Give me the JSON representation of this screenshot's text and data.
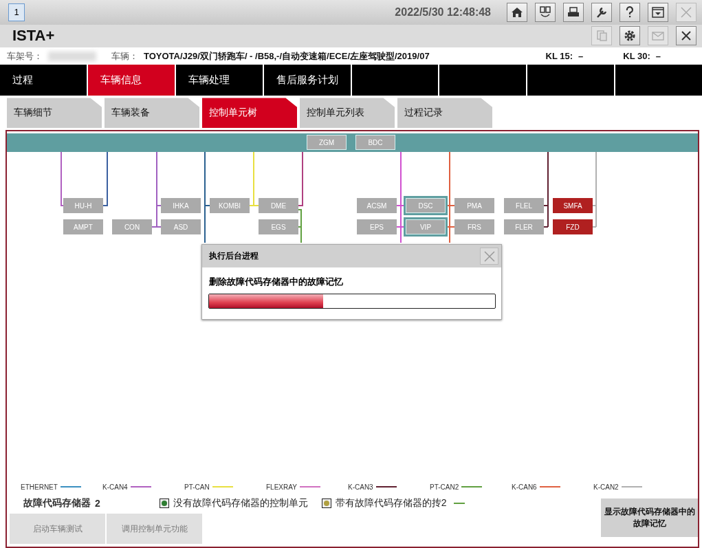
{
  "top_bar": {
    "window_number": "1",
    "datetime": "2022/5/30 12:48:48"
  },
  "app": {
    "title": "ISTA+"
  },
  "vehicle_info": {
    "vin_label": "车架号：",
    "vehicle_label": "车辆：",
    "vehicle": "TOYOTA/J29/双门轿跑车/ - /B58,-/自动变速箱/ECE/左座驾驶型/2019/07",
    "kl15_label": "KL 15:",
    "kl15_value": "–",
    "kl30_label": "KL 30:",
    "kl30_value": "–"
  },
  "main_tabs": [
    {
      "label": "过程",
      "selected": false
    },
    {
      "label": "车辆信息",
      "selected": true
    },
    {
      "label": "车辆处理",
      "selected": false
    },
    {
      "label": "售后服务计划",
      "selected": false
    }
  ],
  "sub_tabs": [
    {
      "label": "车辆细节",
      "selected": false
    },
    {
      "label": "车辆装备",
      "selected": false
    },
    {
      "label": "控制单元树",
      "selected": true
    },
    {
      "label": "控制单元列表",
      "selected": false
    },
    {
      "label": "过程记录",
      "selected": false
    }
  ],
  "bus_nodes": [
    {
      "label": "ZGM"
    },
    {
      "label": "BDC"
    }
  ],
  "ecu_nodes": [
    {
      "label": "HU-H",
      "fault": false,
      "selected": false
    },
    {
      "label": "IHKA",
      "fault": false,
      "selected": false
    },
    {
      "label": "KOMBI",
      "fault": false,
      "selected": false
    },
    {
      "label": "DME",
      "fault": false,
      "selected": false
    },
    {
      "label": "ACSM",
      "fault": false,
      "selected": false
    },
    {
      "label": "DSC",
      "fault": false,
      "selected": true
    },
    {
      "label": "PMA",
      "fault": false,
      "selected": false
    },
    {
      "label": "FLEL",
      "fault": false,
      "selected": false
    },
    {
      "label": "SMFA",
      "fault": true,
      "selected": false
    },
    {
      "label": "AMPT",
      "fault": false,
      "selected": false
    },
    {
      "label": "CON",
      "fault": false,
      "selected": false
    },
    {
      "label": "ASD",
      "fault": false,
      "selected": false
    },
    {
      "label": "EGS",
      "fault": false,
      "selected": false
    },
    {
      "label": "EPS",
      "fault": false,
      "selected": false
    },
    {
      "label": "VIP",
      "fault": false,
      "selected": true
    },
    {
      "label": "FRS",
      "fault": false,
      "selected": false
    },
    {
      "label": "FLER",
      "fault": false,
      "selected": false
    },
    {
      "label": "FZD",
      "fault": true,
      "selected": false
    }
  ],
  "dialog": {
    "title": "执行后台进程",
    "message": "删除故障代码存储器中的故障记忆",
    "level": 0.4
  },
  "legend": [
    {
      "label": "ETHERNET",
      "color": "#3a8fc0"
    },
    {
      "label": "K-CAN4",
      "color": "#b060c0"
    },
    {
      "label": "PT-CAN",
      "color": "#e8e040"
    },
    {
      "label": "FLEXRAY",
      "color": "#d070c0"
    },
    {
      "label": "K-CAN3",
      "color": "#602030"
    },
    {
      "label": "PT-CAN2",
      "color": "#60a040"
    },
    {
      "label": "K-CAN6",
      "color": "#e06040"
    },
    {
      "label": "K-CAN2",
      "color": "#b0b0b0"
    }
  ],
  "fault_memory": {
    "label": "故障代码存储器",
    "count": "2"
  },
  "status_legend": [
    {
      "label": "没有故障代码存储器的控制单元",
      "color": "#2e7d32"
    },
    {
      "label": "带有故障代码存储器的抟2",
      "color": "#b0a040"
    }
  ],
  "buttons": [
    {
      "label": "启动车辆测试",
      "disabled": true
    },
    {
      "label": "调用控制单元功能",
      "disabled": true
    }
  ],
  "action_button": {
    "label": "显示故障代码存储器中的故障记忆"
  }
}
